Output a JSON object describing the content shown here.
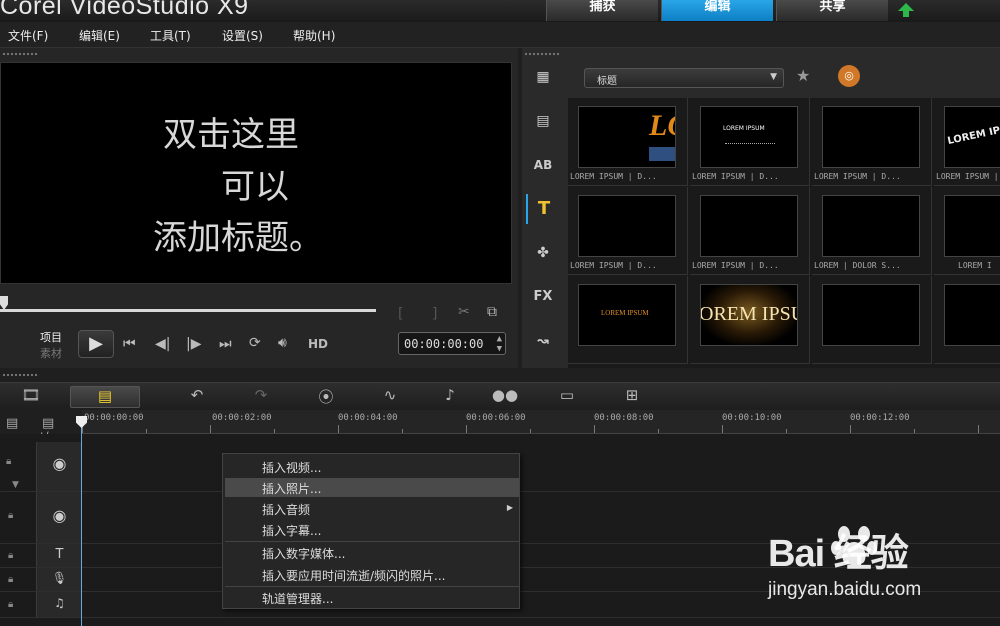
{
  "app": {
    "title": "Corel VideoStudio X9"
  },
  "mode_tabs": [
    {
      "label": "捕获",
      "active": false
    },
    {
      "label": "编辑",
      "active": true
    },
    {
      "label": "共享",
      "active": false
    }
  ],
  "menu": [
    "文件(F)",
    "编辑(E)",
    "工具(T)",
    "设置(S)",
    "帮助(H)"
  ],
  "preview": {
    "lines": [
      "双击这里",
      "可以",
      "添加标题。"
    ],
    "project_label": "项目",
    "clip_label": "素材",
    "hd_label": "HD",
    "timecode": "00:00:00:00"
  },
  "library": {
    "dropdown_value": "标题",
    "categories": [
      "media-icon",
      "instant-project-icon",
      "transition-icon",
      "title-icon",
      "graphic-icon",
      "filter-icon",
      "path-icon"
    ],
    "fx_label": "FX",
    "tiles": [
      {
        "caption": "LOREM IPSUM | D...",
        "thumb_text": "LO"
      },
      {
        "caption": "LOREM IPSUM | D...",
        "thumb_text": "LOREM IPSUM"
      },
      {
        "caption": "LOREM IPSUM | D...",
        "thumb_text": ""
      },
      {
        "caption": "LOREM IPSUM | D...",
        "thumb_text": "LOREM IPSU"
      },
      {
        "caption": "LOREM IPSUM | D...",
        "thumb_text": ""
      },
      {
        "caption": "LOREM IPSUM | D...",
        "thumb_text": ""
      },
      {
        "caption": "LOREM | DOLOR S...",
        "thumb_text": ""
      },
      {
        "caption": "LOREM I",
        "thumb_text": ""
      },
      {
        "caption": "",
        "thumb_text": "LOREM IPSUM"
      },
      {
        "caption": "",
        "thumb_text": "OREM IPSU"
      },
      {
        "caption": "",
        "thumb_text": ""
      },
      {
        "caption": "",
        "thumb_text": ""
      }
    ]
  },
  "timeline": {
    "ruler": [
      "00:00:00:00",
      "00:00:02:00",
      "00:00:04:00",
      "00:00:06:00",
      "00:00:08:00",
      "00:00:10:00",
      "00:00:12:00"
    ],
    "track_add_label": "+/−"
  },
  "context_menu": {
    "items": [
      {
        "label": "插入视频...",
        "highlight": false,
        "submenu": false
      },
      {
        "label": "插入照片...",
        "highlight": true,
        "submenu": false
      },
      {
        "label": "插入音频",
        "highlight": false,
        "submenu": true
      },
      {
        "label": "插入字幕...",
        "highlight": false,
        "submenu": false
      },
      {
        "label": "插入数字媒体...",
        "highlight": false,
        "submenu": false
      },
      {
        "label": "插入要应用时间流逝/频闪的照片...",
        "highlight": false,
        "submenu": false
      },
      {
        "label": "轨道管理器...",
        "highlight": false,
        "submenu": false
      }
    ]
  },
  "watermark": {
    "brand": "Bai 经验",
    "url": "jingyan.baidu.com"
  },
  "colors": {
    "accent": "#1a93d8",
    "title_icon": "#f0c030",
    "playhead": "#6aa8e0"
  }
}
